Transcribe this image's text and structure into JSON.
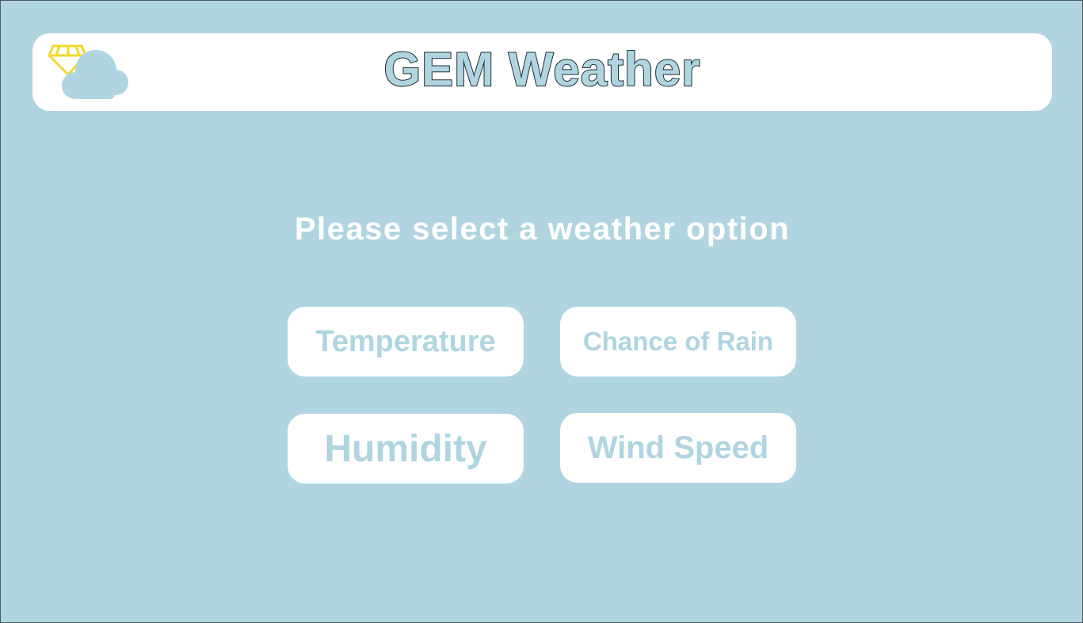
{
  "header": {
    "title": "GEM Weather",
    "logo_icon": "diamond-cloud-icon"
  },
  "prompt": "Please select a weather option",
  "options": [
    {
      "label": "Temperature"
    },
    {
      "label": "Chance of Rain"
    },
    {
      "label": "Humidity"
    },
    {
      "label": "Wind Speed"
    }
  ],
  "colors": {
    "background": "#b0d5e1",
    "card": "#ffffff",
    "accent_text": "#b0d5e1",
    "gem": "#f2d92a",
    "title_outline": "#1d2a33"
  }
}
